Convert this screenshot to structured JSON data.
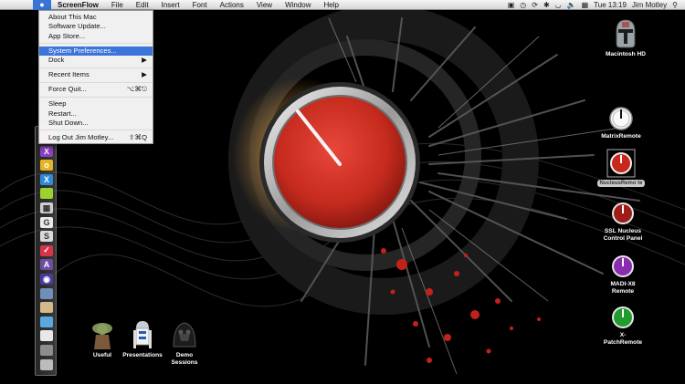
{
  "menubar": {
    "app_name": "ScreenFlow",
    "menus": [
      "File",
      "Edit",
      "Insert",
      "Font",
      "Actions",
      "View",
      "Window",
      "Help"
    ],
    "status": {
      "clock": "Tue 13:19",
      "user": "Jim Motley",
      "icons": [
        "screenflow-record-icon",
        "time-machine-icon",
        "sync-icon",
        "bluetooth-icon",
        "wifi-icon",
        "volume-icon",
        "input-menu-icon",
        "spotlight-icon"
      ]
    }
  },
  "apple_menu": {
    "items": [
      {
        "label": "About This Mac"
      },
      {
        "label": "Software Update..."
      },
      {
        "label": "App Store..."
      },
      {
        "separator": true
      },
      {
        "label": "System Preferences...",
        "highlighted": true
      },
      {
        "label": "Dock",
        "submenu": true
      },
      {
        "separator": true
      },
      {
        "label": "Recent Items",
        "submenu": true
      },
      {
        "separator": true
      },
      {
        "label": "Force Quit...",
        "shortcut": "⌥⌘⎋"
      },
      {
        "separator": true
      },
      {
        "label": "Sleep"
      },
      {
        "label": "Restart..."
      },
      {
        "label": "Shut Down..."
      },
      {
        "separator": true
      },
      {
        "label": "Log Out Jim Motley...",
        "shortcut": "⇧⌘Q"
      }
    ]
  },
  "desktop_icons": {
    "macintosh_hd": "Macintosh HD",
    "matrix_remote": "MatrixRemote",
    "nucleus_remote": "NucleusRemo te",
    "ssl_nucleus_1": "SSL Nucleus",
    "ssl_nucleus_2": "Control Panel",
    "madi_1": "MADI-X8",
    "madi_2": "Remote",
    "xpatch_1": "X-",
    "xpatch_2": "PatchRemote",
    "useful": "Useful",
    "presentations": "Presentations",
    "demo_1": "Demo",
    "demo_2": "Sessions"
  },
  "dock_icons": [
    {
      "name": "dock-app-red-icon",
      "glyph": "",
      "color": "#d23a2a"
    },
    {
      "name": "dock-app-purple-x-icon",
      "glyph": "X",
      "color": "#8d3fc2"
    },
    {
      "name": "dock-app-yellow-icon",
      "glyph": "o",
      "color": "#e6b323"
    },
    {
      "name": "dock-app-blue-x-icon",
      "glyph": "X",
      "color": "#2f8ad8"
    },
    {
      "name": "dock-app-lime-icon",
      "glyph": "",
      "color": "#9bd22e"
    },
    {
      "name": "dock-app-grid-icon",
      "glyph": "▦",
      "color": "#cfcfcf"
    },
    {
      "name": "dock-app-g-icon",
      "glyph": "G",
      "color": "#eaeaea"
    },
    {
      "name": "dock-app-s-icon",
      "glyph": "S",
      "color": "#dadada"
    },
    {
      "name": "dock-app-red-check-icon",
      "glyph": "✓",
      "color": "#d8334a"
    },
    {
      "name": "dock-app-a-icon",
      "glyph": "A",
      "color": "#6d4ea0"
    },
    {
      "name": "dock-app-circle-icon",
      "glyph": "◉",
      "color": "#4a3aa0"
    },
    {
      "name": "dock-app-photo-icon",
      "glyph": "",
      "color": "#6f8fb8"
    },
    {
      "name": "dock-app-scroll-icon",
      "glyph": "",
      "color": "#d6b98a"
    },
    {
      "name": "dock-folder-icon",
      "glyph": "",
      "color": "#5da7e0"
    },
    {
      "name": "dock-document-icon",
      "glyph": "",
      "color": "#e8e8e8"
    },
    {
      "name": "dock-screen-icon",
      "glyph": "",
      "color": "#8d8d8d"
    },
    {
      "name": "dock-trash-icon",
      "glyph": "",
      "color": "#bcbcbc"
    }
  ],
  "colors": {
    "menu_highlight": "#3b74da",
    "knob_red": "#c8281c",
    "knob_green": "#1f9c2c",
    "knob_purple": "#8a2bb0",
    "label_selected": "#c9c9c9"
  }
}
